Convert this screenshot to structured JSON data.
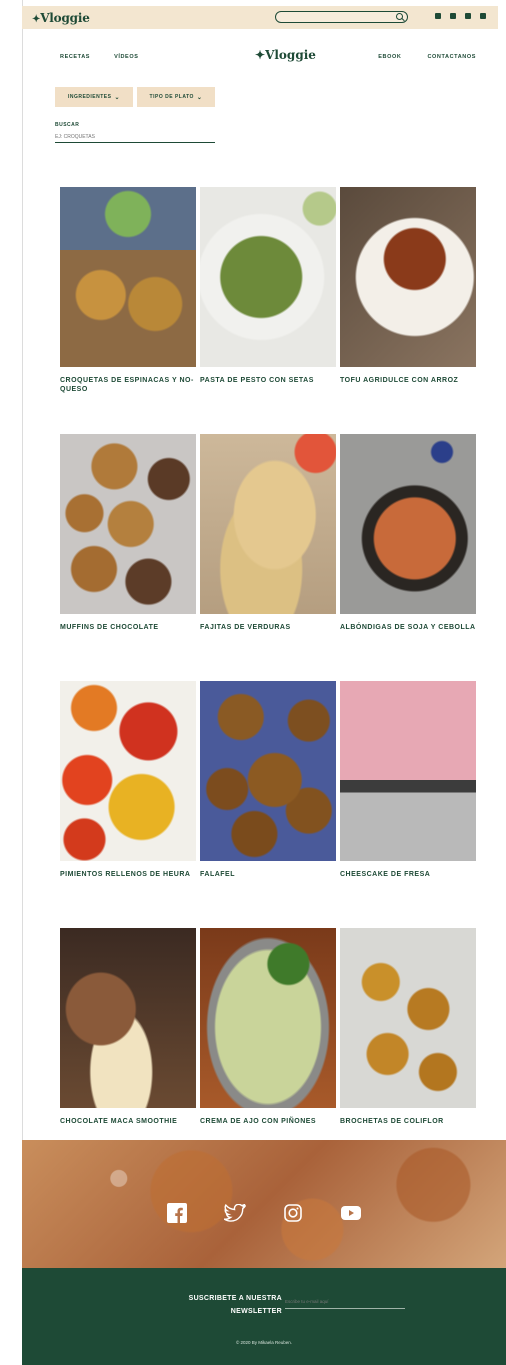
{
  "brand": {
    "name": "Vloggie"
  },
  "topbar": {
    "search_placeholder": ""
  },
  "nav": {
    "left": [
      "RECETAS",
      "VÍDEOS"
    ],
    "right": [
      "EBOOK",
      "CONTACTANOS"
    ]
  },
  "filters": {
    "ingredients": "INGREDIENTES",
    "dish_type": "TIPO DE PLATO",
    "search_label": "BUSCAR",
    "search_placeholder": "EJ: CROQUETAS"
  },
  "recipes": [
    {
      "title": "CROQUETAS DE ESPINACAS Y NO-QUESO"
    },
    {
      "title": "PASTA DE PESTO CON SETAS"
    },
    {
      "title": "TOFU AGRIDULCE CON ARROZ"
    },
    {
      "title": "MUFFINS DE CHOCOLATE"
    },
    {
      "title": "FAJITAS DE VERDURAS"
    },
    {
      "title": "ALBÓNDIGAS DE SOJA Y CEBOLLA"
    },
    {
      "title": "PIMIENTOS RELLENOS DE HEURA"
    },
    {
      "title": "FALAFEL"
    },
    {
      "title": "CHEESCAKE DE FRESA"
    },
    {
      "title": "CHOCOLATE MACA SMOOTHIE"
    },
    {
      "title": "CREMA DE AJO CON PIÑONES"
    },
    {
      "title": "BROCHETAS DE COLIFLOR"
    }
  ],
  "newsletter": {
    "title_line1": "SUSCRIBETE A NUESTRA",
    "title_line2": "NEWSLETTER",
    "placeholder": "Escribe tu e-mail aquí",
    "copyright": "© 2020 By Mikaela Reuben."
  },
  "colors": {
    "brand_green": "#1e4a36",
    "cream": "#f3e6d0"
  }
}
